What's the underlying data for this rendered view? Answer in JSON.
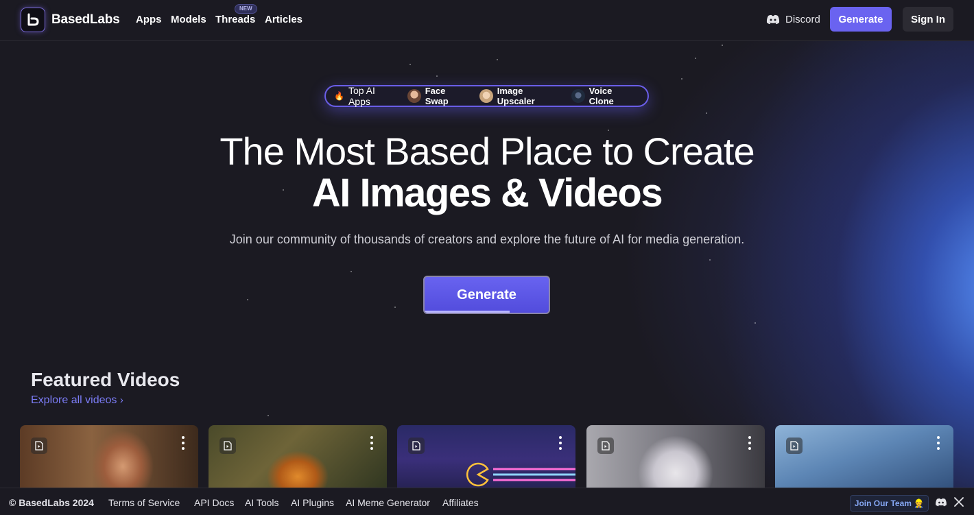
{
  "header": {
    "brand": "BasedLabs",
    "nav": [
      {
        "label": "Apps"
      },
      {
        "label": "Models"
      },
      {
        "label": "Threads",
        "badge": "NEW"
      },
      {
        "label": "Articles"
      }
    ],
    "discord_label": "Discord",
    "generate_label": "Generate",
    "signin_label": "Sign In"
  },
  "top_apps": {
    "title": "Top AI Apps",
    "items": [
      {
        "label": "Face Swap"
      },
      {
        "label": "Image Upscaler"
      },
      {
        "label": "Voice Clone"
      }
    ]
  },
  "hero": {
    "title_line1": "The Most Based Place to Create",
    "title_line2": "AI Images & Videos",
    "subtitle": "Join our community of thousands of creators and explore the future of AI for media generation.",
    "cta_label": "Generate"
  },
  "featured": {
    "title": "Featured Videos",
    "link_label": "Explore all videos"
  },
  "footer": {
    "copyright": "© BasedLabs 2024",
    "links": [
      "Terms of Service",
      "API Docs",
      "AI Tools",
      "AI Plugins",
      "AI Meme Generator",
      "Affiliates"
    ],
    "join_label": "Join Our Team 👷"
  },
  "colors": {
    "accent": "#6a63f0",
    "background": "#1b1a22",
    "link": "#7b7cf5"
  }
}
